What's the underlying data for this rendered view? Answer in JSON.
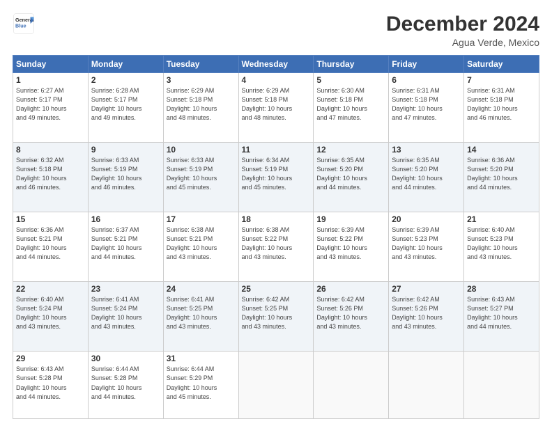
{
  "header": {
    "logo_line1": "General",
    "logo_line2": "Blue",
    "title": "December 2024",
    "subtitle": "Agua Verde, Mexico"
  },
  "days_of_week": [
    "Sunday",
    "Monday",
    "Tuesday",
    "Wednesday",
    "Thursday",
    "Friday",
    "Saturday"
  ],
  "weeks": [
    [
      {
        "day": "1",
        "info": "Sunrise: 6:27 AM\nSunset: 5:17 PM\nDaylight: 10 hours\nand 49 minutes."
      },
      {
        "day": "2",
        "info": "Sunrise: 6:28 AM\nSunset: 5:17 PM\nDaylight: 10 hours\nand 49 minutes."
      },
      {
        "day": "3",
        "info": "Sunrise: 6:29 AM\nSunset: 5:18 PM\nDaylight: 10 hours\nand 48 minutes."
      },
      {
        "day": "4",
        "info": "Sunrise: 6:29 AM\nSunset: 5:18 PM\nDaylight: 10 hours\nand 48 minutes."
      },
      {
        "day": "5",
        "info": "Sunrise: 6:30 AM\nSunset: 5:18 PM\nDaylight: 10 hours\nand 47 minutes."
      },
      {
        "day": "6",
        "info": "Sunrise: 6:31 AM\nSunset: 5:18 PM\nDaylight: 10 hours\nand 47 minutes."
      },
      {
        "day": "7",
        "info": "Sunrise: 6:31 AM\nSunset: 5:18 PM\nDaylight: 10 hours\nand 46 minutes."
      }
    ],
    [
      {
        "day": "8",
        "info": "Sunrise: 6:32 AM\nSunset: 5:18 PM\nDaylight: 10 hours\nand 46 minutes."
      },
      {
        "day": "9",
        "info": "Sunrise: 6:33 AM\nSunset: 5:19 PM\nDaylight: 10 hours\nand 46 minutes."
      },
      {
        "day": "10",
        "info": "Sunrise: 6:33 AM\nSunset: 5:19 PM\nDaylight: 10 hours\nand 45 minutes."
      },
      {
        "day": "11",
        "info": "Sunrise: 6:34 AM\nSunset: 5:19 PM\nDaylight: 10 hours\nand 45 minutes."
      },
      {
        "day": "12",
        "info": "Sunrise: 6:35 AM\nSunset: 5:20 PM\nDaylight: 10 hours\nand 44 minutes."
      },
      {
        "day": "13",
        "info": "Sunrise: 6:35 AM\nSunset: 5:20 PM\nDaylight: 10 hours\nand 44 minutes."
      },
      {
        "day": "14",
        "info": "Sunrise: 6:36 AM\nSunset: 5:20 PM\nDaylight: 10 hours\nand 44 minutes."
      }
    ],
    [
      {
        "day": "15",
        "info": "Sunrise: 6:36 AM\nSunset: 5:21 PM\nDaylight: 10 hours\nand 44 minutes."
      },
      {
        "day": "16",
        "info": "Sunrise: 6:37 AM\nSunset: 5:21 PM\nDaylight: 10 hours\nand 44 minutes."
      },
      {
        "day": "17",
        "info": "Sunrise: 6:38 AM\nSunset: 5:21 PM\nDaylight: 10 hours\nand 43 minutes."
      },
      {
        "day": "18",
        "info": "Sunrise: 6:38 AM\nSunset: 5:22 PM\nDaylight: 10 hours\nand 43 minutes."
      },
      {
        "day": "19",
        "info": "Sunrise: 6:39 AM\nSunset: 5:22 PM\nDaylight: 10 hours\nand 43 minutes."
      },
      {
        "day": "20",
        "info": "Sunrise: 6:39 AM\nSunset: 5:23 PM\nDaylight: 10 hours\nand 43 minutes."
      },
      {
        "day": "21",
        "info": "Sunrise: 6:40 AM\nSunset: 5:23 PM\nDaylight: 10 hours\nand 43 minutes."
      }
    ],
    [
      {
        "day": "22",
        "info": "Sunrise: 6:40 AM\nSunset: 5:24 PM\nDaylight: 10 hours\nand 43 minutes."
      },
      {
        "day": "23",
        "info": "Sunrise: 6:41 AM\nSunset: 5:24 PM\nDaylight: 10 hours\nand 43 minutes."
      },
      {
        "day": "24",
        "info": "Sunrise: 6:41 AM\nSunset: 5:25 PM\nDaylight: 10 hours\nand 43 minutes."
      },
      {
        "day": "25",
        "info": "Sunrise: 6:42 AM\nSunset: 5:25 PM\nDaylight: 10 hours\nand 43 minutes."
      },
      {
        "day": "26",
        "info": "Sunrise: 6:42 AM\nSunset: 5:26 PM\nDaylight: 10 hours\nand 43 minutes."
      },
      {
        "day": "27",
        "info": "Sunrise: 6:42 AM\nSunset: 5:26 PM\nDaylight: 10 hours\nand 43 minutes."
      },
      {
        "day": "28",
        "info": "Sunrise: 6:43 AM\nSunset: 5:27 PM\nDaylight: 10 hours\nand 44 minutes."
      }
    ],
    [
      {
        "day": "29",
        "info": "Sunrise: 6:43 AM\nSunset: 5:28 PM\nDaylight: 10 hours\nand 44 minutes."
      },
      {
        "day": "30",
        "info": "Sunrise: 6:44 AM\nSunset: 5:28 PM\nDaylight: 10 hours\nand 44 minutes."
      },
      {
        "day": "31",
        "info": "Sunrise: 6:44 AM\nSunset: 5:29 PM\nDaylight: 10 hours\nand 45 minutes."
      },
      {
        "day": "",
        "info": ""
      },
      {
        "day": "",
        "info": ""
      },
      {
        "day": "",
        "info": ""
      },
      {
        "day": "",
        "info": ""
      }
    ]
  ]
}
